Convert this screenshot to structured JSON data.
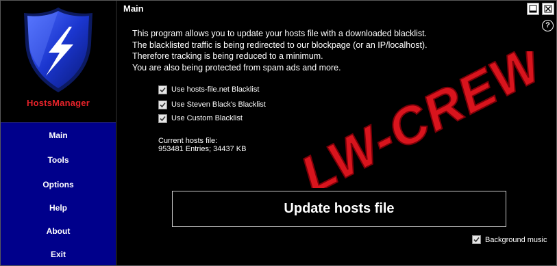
{
  "app": {
    "name": "HostsManager"
  },
  "sidebar": {
    "items": [
      {
        "label": "Main"
      },
      {
        "label": "Tools"
      },
      {
        "label": "Options"
      },
      {
        "label": "Help"
      },
      {
        "label": "About"
      },
      {
        "label": "Exit"
      }
    ]
  },
  "page": {
    "title": "Main",
    "intro": [
      "This program allows you to update your hosts file with a downloaded blacklist.",
      "The blacklisted traffic is being redirected to our blockpage (or an IP/localhost).",
      "Therefore tracking is being reduced to a minimum.",
      "You are also being protected from spam ads and more."
    ],
    "options": [
      {
        "label": "Use hosts-file.net Blacklist",
        "checked": true
      },
      {
        "label": "Use Steven Black's Blacklist",
        "checked": true
      },
      {
        "label": "Use Custom Blacklist",
        "checked": true
      }
    ],
    "hosts_file": {
      "label": "Current hosts file:",
      "value": "953481 Entries; 34437 KB"
    },
    "update_button": "Update hosts file",
    "background_music": {
      "label": "Background music",
      "checked": true
    },
    "watermark_text": "LW-CREW",
    "help_glyph": "?"
  },
  "colors": {
    "nav_bg": "#00008b",
    "app_name": "#e8232a",
    "watermark": "#d8141d",
    "shield": "#1f3fd6"
  },
  "icons": [
    "shield-lightning-icon",
    "minimize-icon",
    "close-icon",
    "help-icon",
    "checkbox-checked-icon"
  ]
}
